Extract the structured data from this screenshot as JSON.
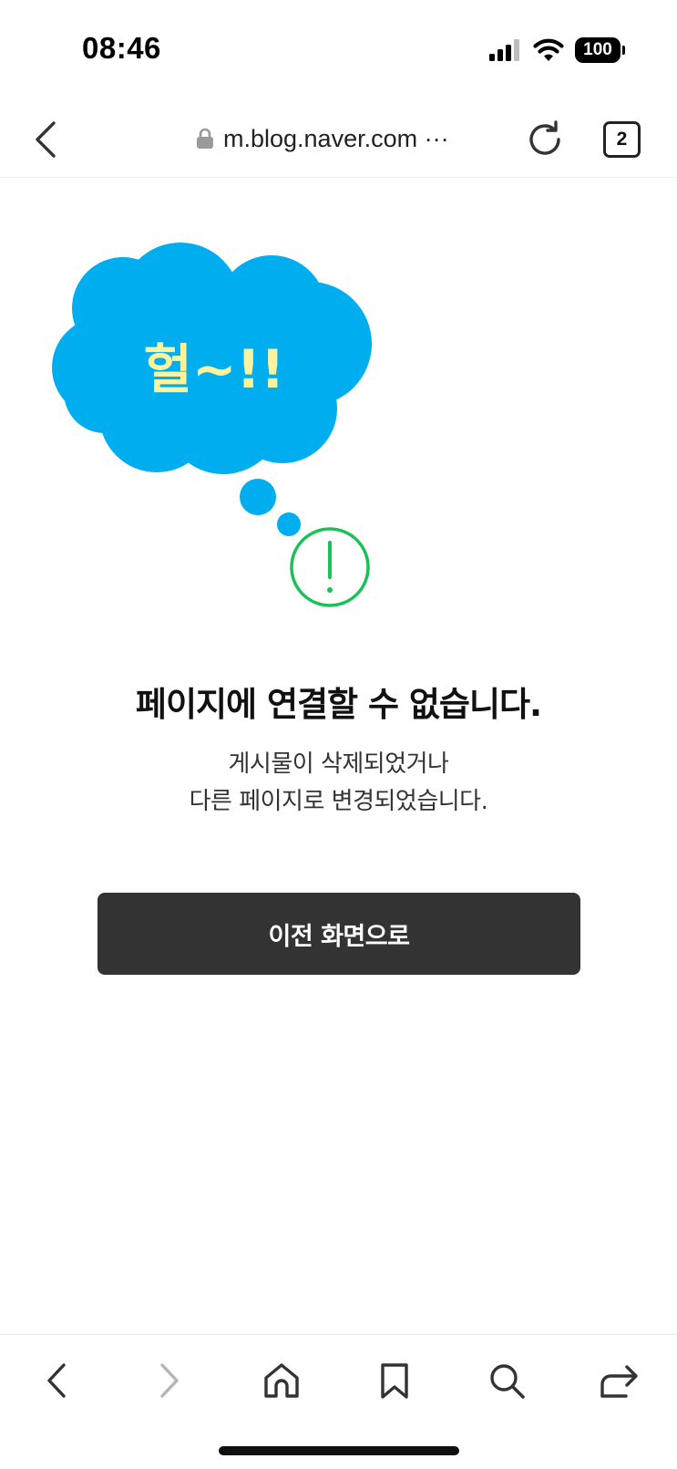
{
  "status_bar": {
    "time": "08:46",
    "battery": "100",
    "icons": [
      "signal-icon",
      "wifi-icon",
      "battery-icon"
    ]
  },
  "url_bar": {
    "url": "m.blog.naver.com ···",
    "tab_count": "2",
    "icons": [
      "back-icon",
      "lock-icon",
      "reload-icon",
      "tabs-icon"
    ]
  },
  "illustration": {
    "bubble_text": "헐~!!",
    "bubble_color": "#00aeef",
    "bubble_text_color": "#fdf39a",
    "alert_color": "#19c157"
  },
  "error": {
    "title": "페이지에 연결할 수 없습니다.",
    "line1": "게시물이 삭제되었거나",
    "line2": "다른 페이지로 변경되었습니다.",
    "button_label": "이전 화면으로"
  },
  "toolbar": {
    "icons": [
      "back-icon",
      "forward-icon",
      "home-icon",
      "bookmark-icon",
      "search-icon",
      "share-icon"
    ]
  }
}
